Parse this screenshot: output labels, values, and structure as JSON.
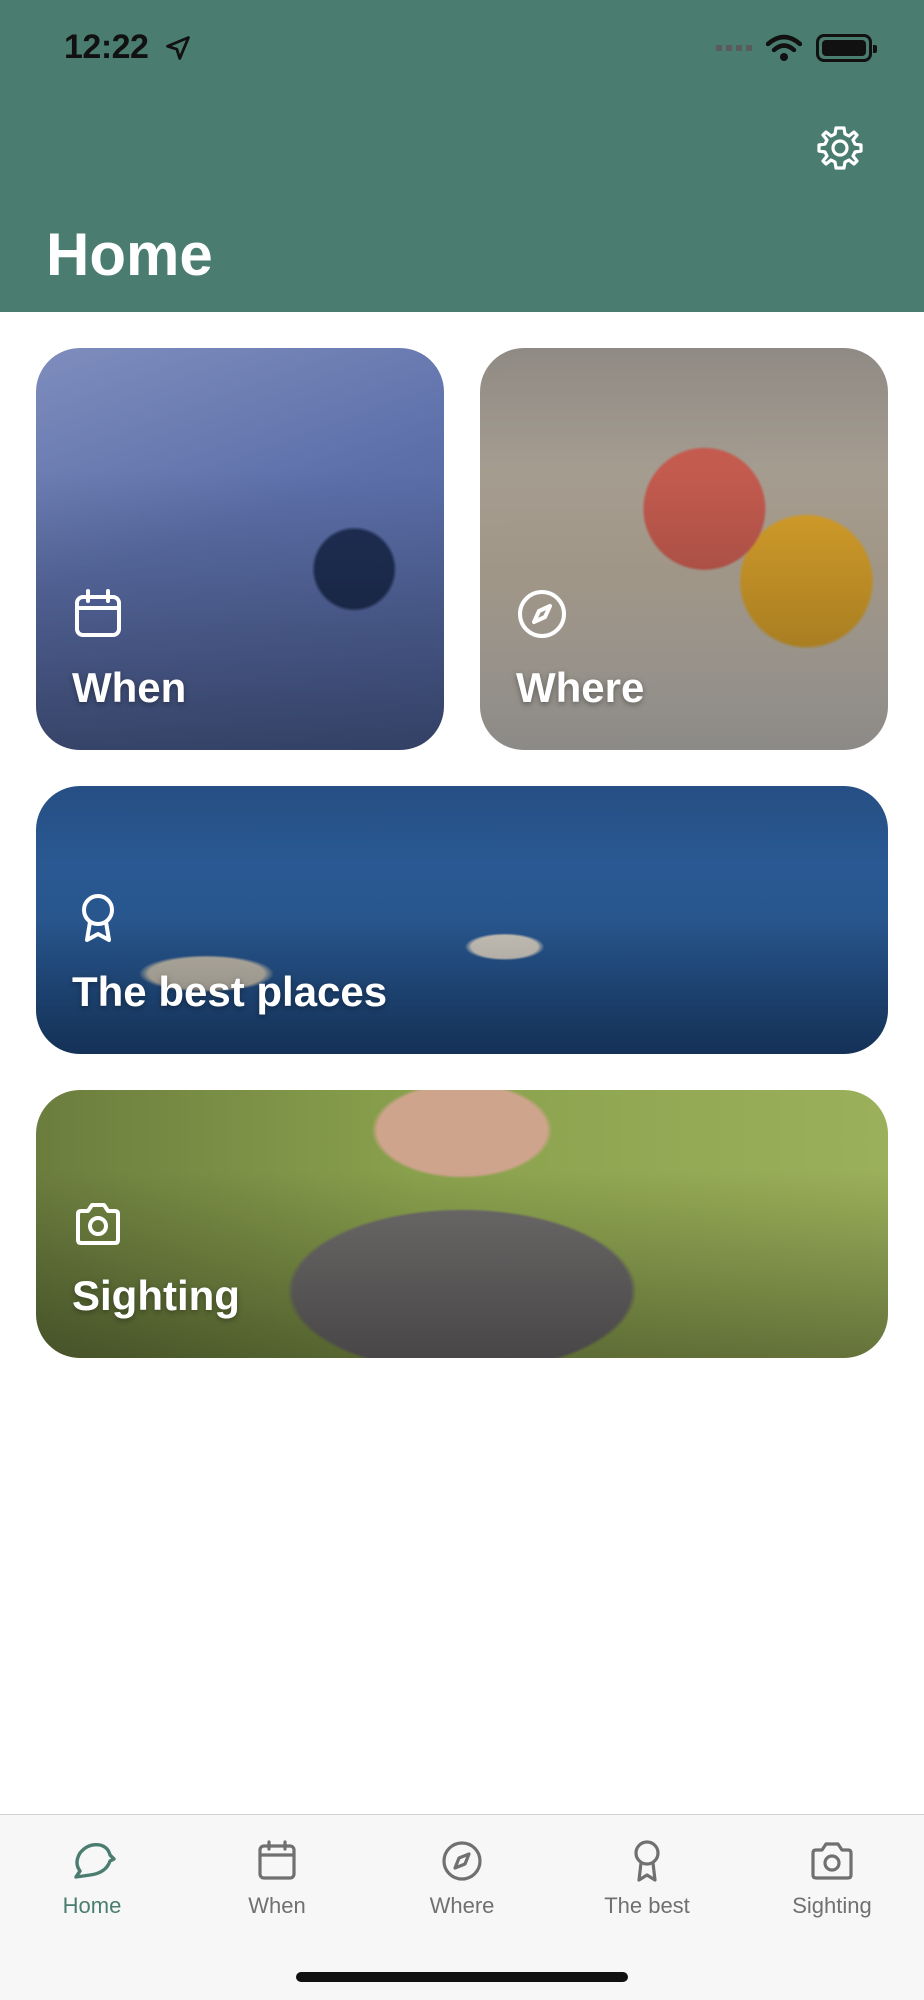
{
  "status_bar": {
    "time": "12:22"
  },
  "header": {
    "title": "Home"
  },
  "cards": {
    "when": {
      "label": "When"
    },
    "where": {
      "label": "Where"
    },
    "best": {
      "label": "The best places"
    },
    "sighting": {
      "label": "Sighting"
    }
  },
  "tabbar": {
    "items": [
      {
        "label": "Home",
        "icon": "chat-bubble-icon",
        "active": true
      },
      {
        "label": "When",
        "icon": "calendar-icon",
        "active": false
      },
      {
        "label": "Where",
        "icon": "compass-icon",
        "active": false
      },
      {
        "label": "The best",
        "icon": "award-icon",
        "active": false
      },
      {
        "label": "Sighting",
        "icon": "camera-icon",
        "active": false
      }
    ]
  },
  "colors": {
    "brand": "#4a7d6f",
    "tab_inactive": "#707070"
  }
}
